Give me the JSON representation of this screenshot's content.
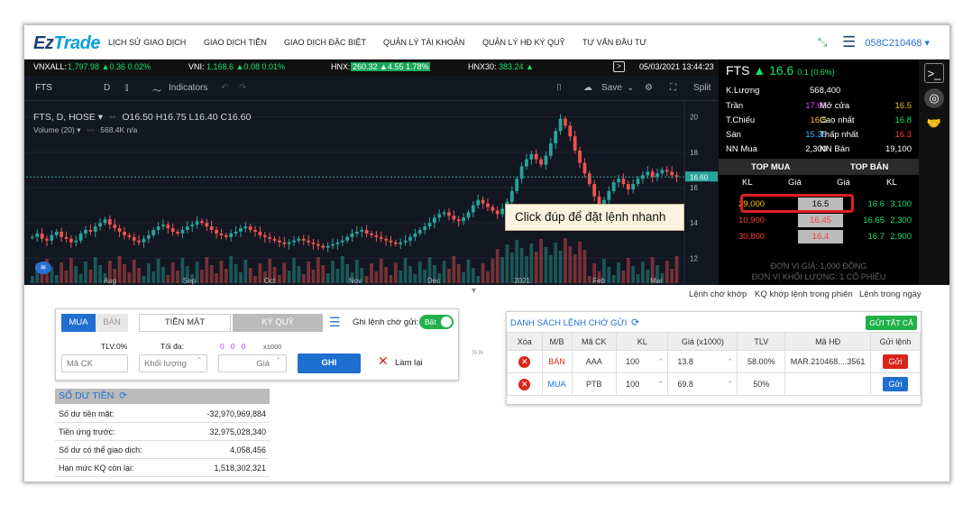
{
  "nav": {
    "logo_ez": "Ez",
    "logo_trade": "Trade",
    "items": [
      "LỊCH SỬ GIAO DỊCH",
      "GIAO DỊCH TIỀN",
      "GIAO DỊCH ĐẶC BIỆT",
      "QUẢN LÝ TÀI KHOẢN",
      "QUẢN LÝ HĐ KÝ QUỸ",
      "TƯ VẤN ĐẦU TƯ"
    ],
    "account": "058C210468 ▾"
  },
  "ticker": {
    "vnxall_label": "VNXALL:",
    "vnxall_value": "1,797.98 ▲0.36 0.02%",
    "vni_label": "VNI:",
    "vni_value": "1,168.6 ▲0.08 0.01%",
    "hnx_label": "HNX:",
    "hnx_value": "260.32 ▲4.55 1.78%",
    "hnx30_label": "HNX30:",
    "hnx30_value": "383.24 ▲",
    "datetime": "05/03/2021 13:44:23"
  },
  "chart_toolbar": {
    "symbol": "FTS",
    "interval": "D",
    "indicators": "Indicators",
    "save": "Save",
    "split": "Split"
  },
  "chart_legend": {
    "title": "FTS, D, HOSE ▾",
    "ohlc": "O16.50  H16.75  L16.40  C16.60",
    "volume_label": "Volume (20) ▾",
    "volume_value": "568.4K  n/a"
  },
  "tooltip": "Click đúp để đặt lệnh nhanh",
  "chart_data": {
    "type": "candlestick",
    "x_ticks": [
      "Aug",
      "Sep",
      "Oct",
      "Nov",
      "Dec",
      "2021",
      "Feb",
      "Mar"
    ],
    "y_ticks": [
      20.0,
      18.0,
      16.0,
      14.0,
      12.0
    ],
    "last_price_label": "16.60",
    "ylim": [
      11.2,
      20.8
    ],
    "close": [
      13.2,
      13.4,
      13.1,
      13.0,
      13.3,
      13.5,
      13.2,
      13.1,
      12.9,
      13.0,
      13.4,
      13.6,
      13.5,
      13.8,
      14.0,
      14.2,
      13.9,
      13.7,
      13.5,
      13.3,
      13.2,
      13.0,
      12.9,
      13.1,
      13.3,
      13.6,
      13.8,
      13.9,
      13.7,
      13.5,
      13.4,
      13.6,
      13.8,
      13.9,
      14.1,
      14.0,
      13.8,
      13.6,
      13.4,
      13.3,
      13.2,
      13.4,
      13.5,
      13.7,
      13.8,
      13.6,
      13.5,
      13.3,
      13.2,
      13.1,
      13.0,
      12.9,
      12.8,
      12.9,
      13.0,
      13.1,
      13.0,
      12.9,
      12.8,
      12.7,
      12.6,
      12.7,
      12.8,
      12.9,
      13.0,
      13.2,
      13.4,
      13.5,
      13.6,
      13.4,
      13.3,
      13.2,
      13.1,
      13.0,
      12.9,
      12.8,
      12.9,
      13.0,
      13.2,
      13.4,
      13.6,
      13.8,
      14.0,
      14.3,
      14.5,
      14.6,
      14.4,
      14.2,
      14.1,
      14.3,
      14.6,
      15.0,
      15.3,
      15.1,
      14.9,
      14.7,
      14.5,
      14.8,
      15.2,
      15.8,
      16.5,
      17.2,
      17.6,
      17.9,
      17.6,
      17.3,
      17.8,
      18.5,
      19.2,
      19.9,
      19.5,
      18.9,
      18.1,
      17.4,
      16.8,
      16.2,
      15.5,
      15.0,
      15.3,
      15.8,
      16.3,
      16.5,
      16.2,
      15.9,
      16.2,
      16.5,
      16.7,
      16.9,
      16.6,
      16.8,
      17.0,
      16.9,
      16.7,
      16.6
    ],
    "volume_label": "568.4K"
  },
  "quote": {
    "symbol": "FTS",
    "arrow": "▲",
    "price": "16.6",
    "change": "0.1 (0.6%)",
    "kl_label": "K.Lượng",
    "kl_value": "568,400",
    "rows": [
      {
        "l1": "Trần",
        "v1": "17.65",
        "c1": "m",
        "l2": "Mở cửa",
        "v2": "16.5",
        "c2": "y"
      },
      {
        "l1": "T.Chiếu",
        "v1": "16.5",
        "c1": "y",
        "l2": "Cao nhất",
        "v2": "16.8",
        "c2": "g"
      },
      {
        "l1": "Sàn",
        "v1": "15.35",
        "c1": "c",
        "l2": "Thấp nhất",
        "v2": "16.3",
        "c2": "r"
      },
      {
        "l1": "NN Mua",
        "v1": "2,300",
        "c1": "w",
        "l2": "NN Bán",
        "v2": "19,100",
        "c2": "w"
      }
    ],
    "top_buy": "TOP MUA",
    "top_sell": "TOP BÁN",
    "col_kl": "KL",
    "col_gia": "Giá",
    "book": [
      {
        "bkl": "29,000",
        "bgia": "16.5",
        "sgia": "16.6",
        "skl": "3,100"
      },
      {
        "bkl": "10,900",
        "bgia": "16.45",
        "sgia": "16.65",
        "skl": "2,300"
      },
      {
        "bkl": "30,800",
        "bgia": "16.4",
        "sgia": "16.7",
        "skl": "2,900"
      }
    ],
    "unit_price": "ĐƠN VỊ GIÁ: 1,000 ĐỒNG",
    "unit_volume": "ĐƠN VỊ KHỐI LƯỢNG: 1 CỔ PHIẾU"
  },
  "links": [
    "Lệnh chờ khớp",
    "KQ khớp lệnh trong phiên",
    "Lệnh trong ngày"
  ],
  "order_form": {
    "buy": "MUA",
    "sell": "BÁN",
    "cash": "TIỀN MẶT",
    "margin": "KÝ QUỸ",
    "pending_label": "Ghi lệnh chờ gửi:",
    "toggle": "Bật",
    "tlv_label": "TLV:0%",
    "max_label": "Tối đa:",
    "max_values": "0   0   0",
    "x1000": "x1000",
    "symbol_ph": "Mã CK",
    "qty_ph": "Khối lượng",
    "price_ph": "Giá",
    "submit": "GHI",
    "reset": "Làm lại"
  },
  "balance": {
    "title": "SỐ DƯ TIỀN",
    "rows": [
      {
        "label": "Số dư tiền mặt:",
        "value": "-32,970,969,884"
      },
      {
        "label": "Tiền ứng trước:",
        "value": "32,975,028,340"
      },
      {
        "label": "Số dư có thể giao dịch:",
        "value": "4,058,456"
      },
      {
        "label": "Hạn mức KQ còn lại:",
        "value": "1,518,302,321"
      }
    ]
  },
  "pending": {
    "title": "DANH SÁCH LỆNH CHỜ GỬI",
    "send_all": "GỬI TẤT CẢ",
    "headers": [
      "Xóa",
      "M/B",
      "Mã CK",
      "KL",
      "Giá (x1000)",
      "TLV",
      "Mã HĐ",
      "Gửi lệnh"
    ],
    "rows": [
      {
        "side": "BÁN",
        "side_color": "#d9261c",
        "sym": "AAA",
        "kl": "100",
        "gia": "13.8",
        "tlv": "58.00%",
        "hd": "MAR.210468....3561",
        "send": "Gửi",
        "send_color": "#d9261c"
      },
      {
        "side": "MUA",
        "side_color": "#1f6fd1",
        "sym": "PTB",
        "kl": "100",
        "gia": "69.8",
        "tlv": "50%",
        "hd": "",
        "send": "Gửi",
        "send_color": "#1f6fd1"
      }
    ]
  }
}
